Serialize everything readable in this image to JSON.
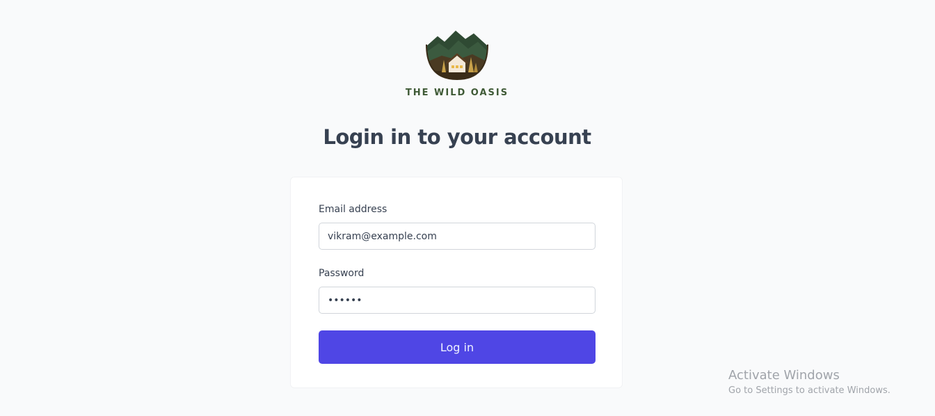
{
  "brand": {
    "name": "THE WILD OASIS",
    "logo_icon": "mountain-cabin-logo-icon"
  },
  "heading": "Login in to your account",
  "form": {
    "email": {
      "label": "Email address",
      "value": "vikram@example.com"
    },
    "password": {
      "label": "Password",
      "value": "••••••"
    },
    "submit_label": "Log in"
  },
  "watermark": {
    "title": "Activate Windows",
    "subtitle": "Go to Settings to activate Windows."
  },
  "colors": {
    "background": "#f9fafb",
    "primary_button": "#4f46e5",
    "brand_text": "#3f5a36",
    "heading_text": "#374151"
  }
}
